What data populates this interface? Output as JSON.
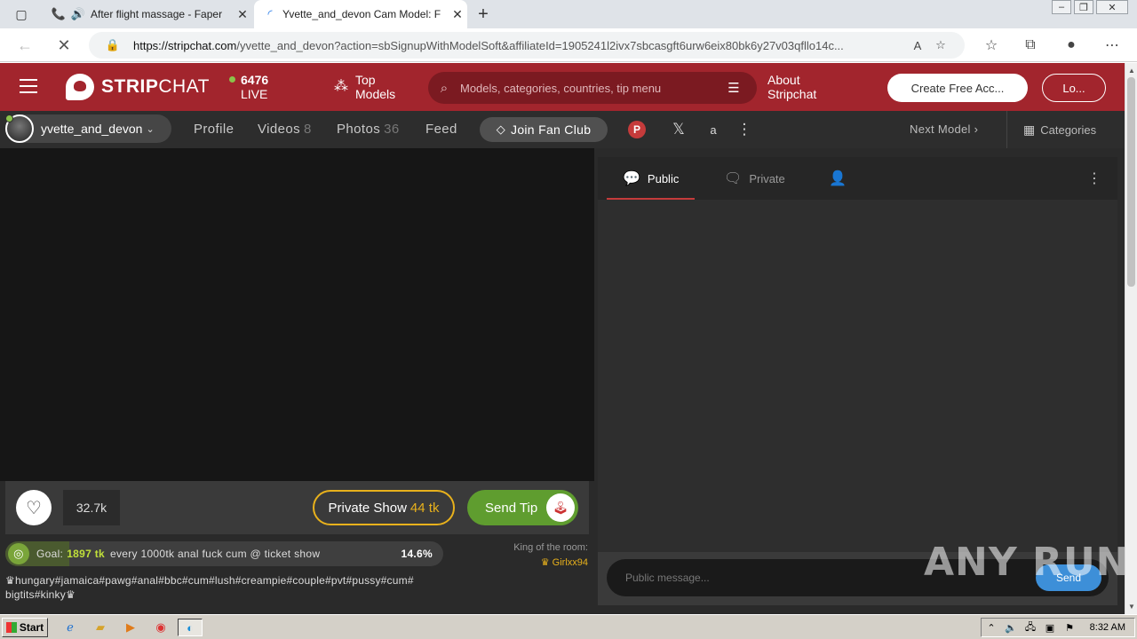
{
  "browser": {
    "tabs": [
      {
        "title": "After flight massage - Faper",
        "icon": "phone-icon"
      },
      {
        "title": "Yvette_and_devon Cam Model: F",
        "icon": "loading-icon"
      }
    ],
    "url_domain": "https://stripchat.com",
    "url_path": "/yvette_and_devon?action=sbSignupWithModelSoft&affiliateId=1905241l2ivx7sbcasgft6urw6eix80bk6y27v03qfllo14c..."
  },
  "site": {
    "brand_bold": "STRIP",
    "brand_regular": "CHAT",
    "live_count": "6476",
    "live_label": "LIVE",
    "top_models_line1": "Top",
    "top_models_line2": "Models",
    "search_placeholder": "Models, categories, countries, tip menu",
    "about_line1": "About",
    "about_line2": "Stripchat",
    "create_account": "Create Free Acc...",
    "login": "Lo...",
    "accent_color": "#a2252d"
  },
  "model": {
    "name": "yvette_and_devon",
    "tabs": [
      {
        "label": "Profile",
        "count": ""
      },
      {
        "label": "Videos",
        "count": "8"
      },
      {
        "label": "Photos",
        "count": "36"
      },
      {
        "label": "Feed",
        "count": ""
      }
    ],
    "fan_club": "Join Fan Club",
    "next_model": "Next Model",
    "categories": "Categories"
  },
  "stream": {
    "likes": "32.7k",
    "private_show_label": "Private Show",
    "private_show_price": "44 tk",
    "send_tip": "Send Tip",
    "goal_label": "Goal:",
    "goal_tokens": "1897 tk",
    "goal_desc": "every 1000tk anal fuck cum @ ticket show",
    "goal_percent": "14.6%",
    "goal_progress": 0.146,
    "king_label": "King of the room:",
    "king_name": "Girlxx94",
    "tags_line1": "♛hungary#jamaica#pawg#anal#bbc#cum#lush#creampie#couple#pvt#pussy#cum#",
    "tags_line2": "bigtits#kinky♛"
  },
  "chat": {
    "tab_public": "Public",
    "tab_private": "Private",
    "input_placeholder": "Public message...",
    "send": "Send"
  },
  "watermark": "ANY RUN",
  "taskbar": {
    "start": "Start",
    "clock": "8:32 AM"
  }
}
